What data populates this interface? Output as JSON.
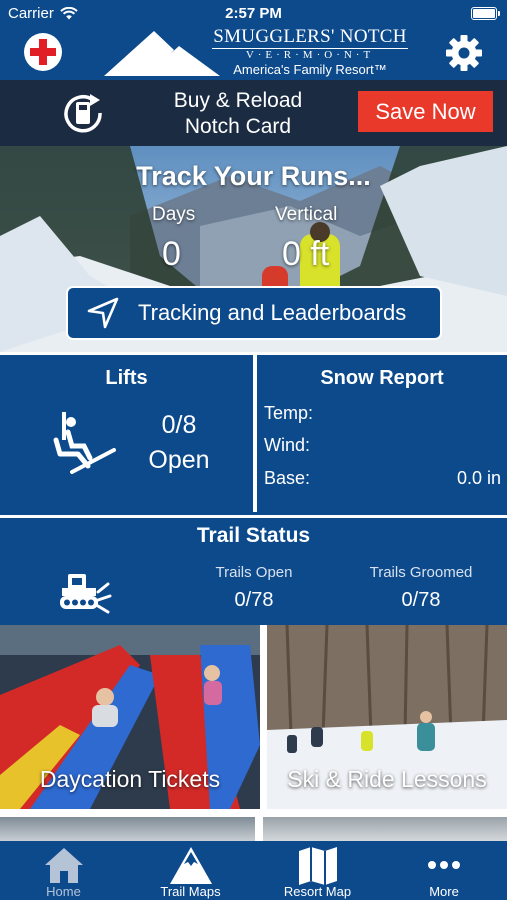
{
  "status_bar": {
    "carrier": "Carrier",
    "time": "2:57 PM"
  },
  "header": {
    "logo_name": "SMUGGLERS' NOTCH",
    "logo_state": "V·E·R·M·O·N·T",
    "logo_tagline": "America's Family Resort™"
  },
  "promo": {
    "line1": "Buy & Reload",
    "line2": "Notch Card",
    "save_label": "Save Now"
  },
  "hero": {
    "title": "Track Your Runs...",
    "days_label": "Days",
    "days_value": "0",
    "vertical_label": "Vertical",
    "vertical_value": "0 ft",
    "button_label": "Tracking and Leaderboards"
  },
  "lifts": {
    "title": "Lifts",
    "count": "0/8",
    "status": "Open"
  },
  "snow_report": {
    "title": "Snow Report",
    "rows": [
      {
        "label": "Temp:",
        "value": ""
      },
      {
        "label": "Wind:",
        "value": ""
      },
      {
        "label": "Base:",
        "value": "0.0 in"
      }
    ]
  },
  "trail_status": {
    "title": "Trail Status",
    "open_label": "Trails Open",
    "open_value": "0/78",
    "groomed_label": "Trails Groomed",
    "groomed_value": "0/78"
  },
  "tiles": [
    {
      "label": "Daycation Tickets"
    },
    {
      "label": "Ski & Ride Lessons"
    }
  ],
  "tabbar": {
    "items": [
      {
        "label": "Home",
        "icon": "home-icon"
      },
      {
        "label": "Trail Maps",
        "icon": "mountain-icon"
      },
      {
        "label": "Resort Map",
        "icon": "map-icon"
      },
      {
        "label": "More",
        "icon": "more-icon"
      }
    ]
  },
  "colors": {
    "brand_blue": "#0d4a8c",
    "promo_dark": "#1a2b42",
    "save_red": "#e8392b",
    "cross_red": "#e11d25",
    "jacket_yellow": "#d8e22a"
  }
}
